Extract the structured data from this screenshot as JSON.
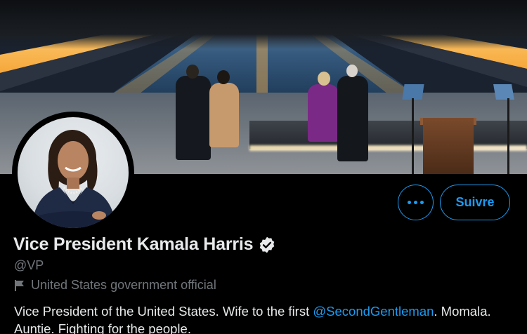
{
  "profile": {
    "display_name": "Vice President Kamala Harris",
    "handle": "@VP",
    "category": "United States government official",
    "verified": true,
    "bio": {
      "before": "Vice President of the United States. Wife to the first ",
      "mention": "@SecondGentleman",
      "after": ". Momala. Auntie. Fighting for the people."
    }
  },
  "actions": {
    "more_icon": "more-dots-icon",
    "follow_label": "Suivre"
  },
  "colors": {
    "accent": "#1d9bf0",
    "background": "#000000",
    "primary_text": "#e7e9ea",
    "secondary_text": "#71767b"
  },
  "icons": {
    "verified": "verified-badge-icon",
    "category": "flag-icon"
  }
}
